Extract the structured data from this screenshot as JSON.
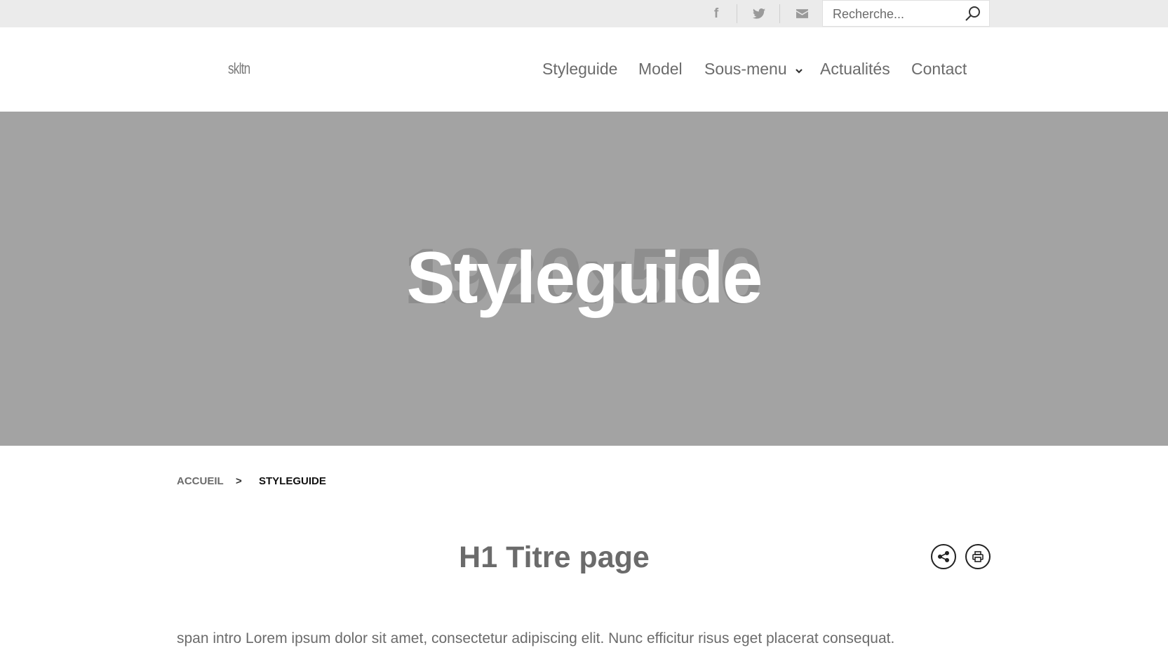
{
  "topbar": {
    "social": [
      {
        "name": "facebook-icon",
        "glyph": "f"
      },
      {
        "name": "twitter-icon"
      },
      {
        "name": "mail-icon"
      }
    ],
    "search": {
      "placeholder": "Recherche...",
      "value": ""
    }
  },
  "header": {
    "logo": "skltn",
    "nav": [
      "Styleguide",
      "Model",
      "Sous-menu",
      "Actualités",
      "Contact"
    ]
  },
  "hero": {
    "placeholder_size": "1920x550",
    "title": "Styleguide"
  },
  "breadcrumb": {
    "home": "ACCUEIL",
    "separator": ">",
    "current": "STYLEGUIDE"
  },
  "page": {
    "title": "H1 Titre page",
    "intro": "span intro Lorem ipsum dolor sit amet, consectetur adipiscing elit. Nunc efficitur risus eget placerat consequat."
  },
  "colors": {
    "topbar_bg": "#ebebeb",
    "hero_bg": "#a3a3a3",
    "text": "#6b6b6b"
  }
}
